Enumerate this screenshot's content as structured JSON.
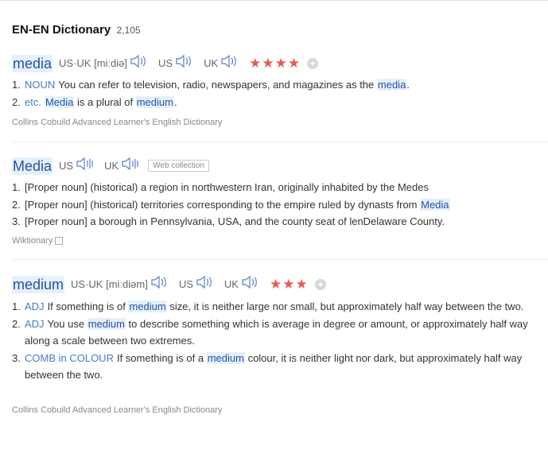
{
  "header": {
    "title": "EN-EN Dictionary",
    "count": "2,105"
  },
  "entry1": {
    "headword": "media",
    "phon_regions": "US·UK",
    "phonetic": "[miːdiə]",
    "us": "US",
    "uk": "UK",
    "stars": "★★★★",
    "defs": [
      {
        "num": "1.",
        "pos": "NOUN",
        "pre": "You can refer to television, radio, newspapers, and magazines as the ",
        "hl": "media",
        "post": "."
      },
      {
        "num": "2.",
        "pos": "etc.",
        "hl1": "Media",
        "mid": " is a plural of ",
        "hl2": "medium",
        "post": "."
      }
    ],
    "source": "Collins Cobuild Advanced Learner's English Dictionary"
  },
  "entry2": {
    "headword": "Media",
    "us": "US",
    "uk": "UK",
    "tag": "Web collection",
    "defs": [
      {
        "num": "1.",
        "text": "[Proper noun] (historical) a region in northwestern Iran, originally inhabited by the Medes"
      },
      {
        "num": "2.",
        "pre": "[Proper noun] (historical) territories corresponding to the empire ruled by dynasts from ",
        "hl": "Media"
      },
      {
        "num": "3.",
        "text": "[Proper noun] a borough in Pennsylvania, USA, and the county seat of lenDelaware County."
      }
    ],
    "source": "Wiktionary"
  },
  "entry3": {
    "headword": "medium",
    "phon_regions": "US·UK",
    "phonetic": "[miːdiəm]",
    "us": "US",
    "uk": "UK",
    "stars": "★★★",
    "defs": [
      {
        "num": "1.",
        "pos": "ADJ",
        "pre": "If something is of ",
        "hl": "medium",
        "post": " size, it is neither large nor small, but approximately half way between the two."
      },
      {
        "num": "2.",
        "pos": "ADJ",
        "pre": "You use ",
        "hl": "medium",
        "post": " to describe something which is average in degree or amount, or approximately half way along a scale between two extremes."
      },
      {
        "num": "3.",
        "pos": "COMB in COLOUR",
        "pre": "If something is of a ",
        "hl": "medium",
        "post": " colour, it is neither light nor dark, but approximately half way between the two."
      }
    ],
    "source": "Collins Cobuild Advanced Learner's English Dictionary"
  },
  "icons": {
    "speaker": "speaker-icon",
    "plus": "plus-icon",
    "external": "external-link-icon"
  },
  "colors": {
    "headword": "#2352a8",
    "highlight_bg": "#e6f0fb",
    "pos": "#4a7ac8",
    "stars": "#e85a50"
  }
}
